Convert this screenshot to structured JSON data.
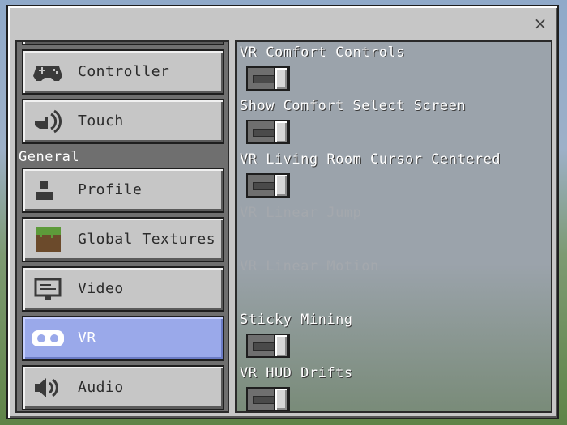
{
  "window": {
    "close_glyph": "×"
  },
  "sidebar": {
    "items": [
      {
        "label": "",
        "icon": "partial-item"
      },
      {
        "label": "Controller",
        "icon": "gamepad-icon"
      },
      {
        "label": "Touch",
        "icon": "touch-icon"
      },
      {
        "section": "General"
      },
      {
        "label": "Profile",
        "icon": "profile-icon"
      },
      {
        "label": "Global Textures",
        "icon": "grass-block-icon"
      },
      {
        "label": "Video",
        "icon": "video-icon"
      },
      {
        "label": "VR",
        "icon": "vr-headset-icon",
        "active": true
      },
      {
        "label": "Audio",
        "icon": "speaker-icon"
      }
    ]
  },
  "settings": [
    {
      "label": "VR Comfort Controls",
      "toggle": true,
      "state": "on"
    },
    {
      "label": "Show Comfort Select Screen",
      "toggle": true,
      "state": "on"
    },
    {
      "label": "VR Living Room Cursor Centered",
      "toggle": true,
      "state": "on"
    },
    {
      "label": "VR Linear Jump",
      "toggle": false,
      "disabled": true
    },
    {
      "label": "VR Linear Motion",
      "toggle": false,
      "disabled": true
    },
    {
      "label": "Sticky Mining",
      "toggle": true,
      "state": "on"
    },
    {
      "label": "VR HUD Drifts",
      "toggle": true,
      "state": "on"
    }
  ],
  "colors": {
    "panel": "#c6c6c6",
    "active_item": "#9aa9ea",
    "disabled_text": "#a4a8ad"
  }
}
